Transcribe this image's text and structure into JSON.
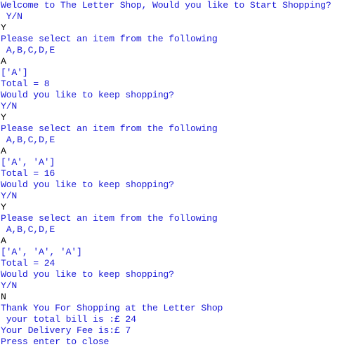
{
  "console": {
    "lines": [
      {
        "text": "Welcome to The Letter Shop, Would you like to Start Shopping?",
        "kind": "output"
      },
      {
        "text": " Y/N",
        "kind": "output"
      },
      {
        "text": "Y",
        "kind": "input"
      },
      {
        "text": "Please select an item from the following",
        "kind": "output"
      },
      {
        "text": " A,B,C,D,E",
        "kind": "output"
      },
      {
        "text": "A",
        "kind": "input"
      },
      {
        "text": "['A']",
        "kind": "output"
      },
      {
        "text": "Total = 8",
        "kind": "output"
      },
      {
        "text": "Would you like to keep shopping?",
        "kind": "output"
      },
      {
        "text": "Y/N",
        "kind": "output"
      },
      {
        "text": "Y",
        "kind": "input"
      },
      {
        "text": "Please select an item from the following",
        "kind": "output"
      },
      {
        "text": " A,B,C,D,E",
        "kind": "output"
      },
      {
        "text": "A",
        "kind": "input"
      },
      {
        "text": "['A', 'A']",
        "kind": "output"
      },
      {
        "text": "Total = 16",
        "kind": "output"
      },
      {
        "text": "Would you like to keep shopping?",
        "kind": "output"
      },
      {
        "text": "Y/N",
        "kind": "output"
      },
      {
        "text": "Y",
        "kind": "input"
      },
      {
        "text": "Please select an item from the following",
        "kind": "output"
      },
      {
        "text": " A,B,C,D,E",
        "kind": "output"
      },
      {
        "text": "A",
        "kind": "input"
      },
      {
        "text": "['A', 'A', 'A']",
        "kind": "output"
      },
      {
        "text": "Total = 24",
        "kind": "output"
      },
      {
        "text": "Would you like to keep shopping?",
        "kind": "output"
      },
      {
        "text": "Y/N",
        "kind": "output"
      },
      {
        "text": "N",
        "kind": "input"
      },
      {
        "text": "Thank You For Shopping at the Letter Shop",
        "kind": "output"
      },
      {
        "text": " your total bill is :£ 24",
        "kind": "output"
      },
      {
        "text": "Your Delivery Fee is:£ 7",
        "kind": "output"
      },
      {
        "text": "Press enter to close",
        "kind": "output"
      }
    ],
    "colors": {
      "output": "#1a1ad6",
      "input": "#000000",
      "background": "#ffffff"
    }
  }
}
